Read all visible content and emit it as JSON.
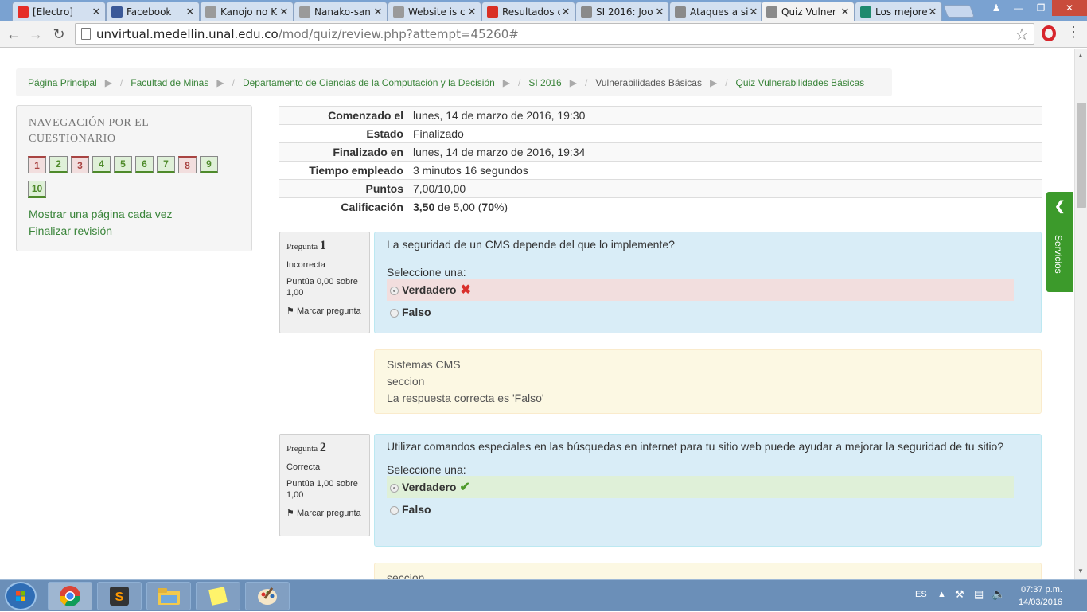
{
  "browser": {
    "tabs": [
      {
        "label": "[Electro]",
        "favicon": "youtube-icon",
        "color": "#e52d27"
      },
      {
        "label": "Facebook",
        "favicon": "facebook-icon",
        "color": "#3b5998"
      },
      {
        "label": "Kanojo no K",
        "favicon": "site-icon",
        "color": "#9a9a9a"
      },
      {
        "label": "Nanako-san",
        "favicon": "site-icon",
        "color": "#9a9a9a"
      },
      {
        "label": "Website is c",
        "favicon": "site-icon",
        "color": "#9a9a9a"
      },
      {
        "label": "Resultados c",
        "favicon": "gmail-icon",
        "color": "#d93025"
      },
      {
        "label": "SI 2016: Joo",
        "favicon": "moodle-icon",
        "color": "#8a8a8a"
      },
      {
        "label": "Ataques a si",
        "favicon": "page-icon",
        "color": "#8a8a8a"
      },
      {
        "label": "Quiz Vulner",
        "favicon": "moodle-icon",
        "color": "#8a8a8a",
        "active": true
      },
      {
        "label": "Los mejores",
        "favicon": "site-icon",
        "color": "#1e8a6e"
      }
    ],
    "url_host": "unvirtual.medellin.unal.edu.co",
    "url_path": "/mod/quiz/review.php?attempt=45260#"
  },
  "breadcrumb": [
    "Página Principal",
    "Facultad de Minas",
    "Departamento de Ciencias de la Computación y la Decisión",
    "SI 2016",
    "Vulnerabilidades Básicas",
    "Quiz Vulnerabilidades Básicas"
  ],
  "nav": {
    "title": "NAVEGACIÓN POR EL CUESTIONARIO",
    "questions": [
      {
        "n": "1",
        "state": "incorrect"
      },
      {
        "n": "2",
        "state": "correct"
      },
      {
        "n": "3",
        "state": "incorrect"
      },
      {
        "n": "4",
        "state": "correct"
      },
      {
        "n": "5",
        "state": "correct"
      },
      {
        "n": "6",
        "state": "correct"
      },
      {
        "n": "7",
        "state": "correct"
      },
      {
        "n": "8",
        "state": "incorrect"
      },
      {
        "n": "9",
        "state": "correct"
      },
      {
        "n": "10",
        "state": "correct"
      }
    ],
    "show_one_page": "Mostrar una página cada vez",
    "finish_review": "Finalizar revisión"
  },
  "summary": {
    "started_label": "Comenzado el",
    "started_value": "lunes, 14 de marzo de 2016, 19:30",
    "state_label": "Estado",
    "state_value": "Finalizado",
    "finished_label": "Finalizado en",
    "finished_value": "lunes, 14 de marzo de 2016, 19:34",
    "time_label": "Tiempo empleado",
    "time_value": "3 minutos 16 segundos",
    "points_label": "Puntos",
    "points_value": "7,00/10,00",
    "grade_label": "Calificación",
    "grade_score": "3,50",
    "grade_of": " de 5,00 (",
    "grade_pct": "70",
    "grade_end": "%)"
  },
  "questions": [
    {
      "word": "Pregunta",
      "number": "1",
      "state": "Incorrecta",
      "grade": "Puntúa 0,00 sobre 1,00",
      "flag": "Marcar pregunta",
      "text": "La seguridad de un CMS depende del que lo implemente?",
      "prompt": "Seleccione una:",
      "option_a": "Verdadero",
      "option_b": "Falso",
      "feedback": [
        "Sistemas CMS",
        "seccion",
        "La respuesta correcta es 'Falso'"
      ]
    },
    {
      "word": "Pregunta",
      "number": "2",
      "state": "Correcta",
      "grade": "Puntúa 1,00 sobre 1,00",
      "flag": "Marcar pregunta",
      "text": "Utilizar comandos especiales en las búsquedas en internet para tu sitio web puede ayudar a mejorar la seguridad de tu sitio?",
      "prompt": "Seleccione una:",
      "option_a": "Verdadero",
      "option_b": "Falso",
      "feedback": [
        "seccion"
      ]
    }
  ],
  "servicios": "Servicios",
  "taskbar": {
    "lang": "ES",
    "time": "07:37 p.m.",
    "date": "14/03/2016"
  },
  "colors": {
    "link_green": "#398439",
    "correct_bg": "#dff0d8",
    "incorrect_bg": "#f2dede",
    "question_bg": "#d9edf7",
    "feedback_bg": "#fcf8e3",
    "servicios_green": "#3c9a2b"
  }
}
